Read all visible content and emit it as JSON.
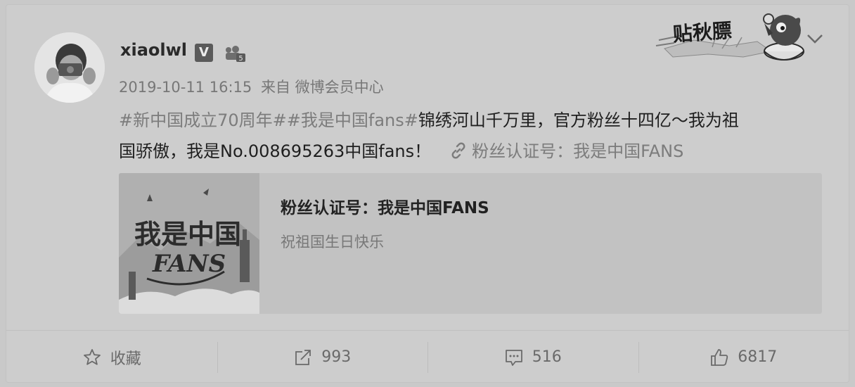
{
  "post": {
    "username": "xiaolwl",
    "verified_badge": "V",
    "time": "2019-10-11 16:15",
    "source_prefix": "来自",
    "source": "微博会员中心",
    "sticker_text": "贴秋膘",
    "content": {
      "tags": "#新中国成立70周年##我是中国fans#",
      "text_line1": "锦绣河山千万里，官方粉丝十四亿～我为祖",
      "text_line2": "国骄傲，我是No.008695263中国fans！",
      "link_text": "粉丝认证号：我是中国FANS"
    },
    "card": {
      "title": "粉丝认证号：我是中国FANS",
      "subtitle": "祝祖国生日快乐"
    }
  },
  "actions": {
    "favorite_label": "收藏",
    "repost_count": "993",
    "comment_count": "516",
    "like_count": "6817"
  },
  "icons": {
    "favorite": "star-icon",
    "repost": "share-arrow-icon",
    "comment": "comment-bubble-icon",
    "like": "thumbs-up-icon",
    "link": "link-chain-icon",
    "expand": "chevron-down-icon"
  },
  "colors": {
    "background": "#cdcdcd",
    "tag": "#7c7c7c",
    "text": "#1f1f1f"
  }
}
